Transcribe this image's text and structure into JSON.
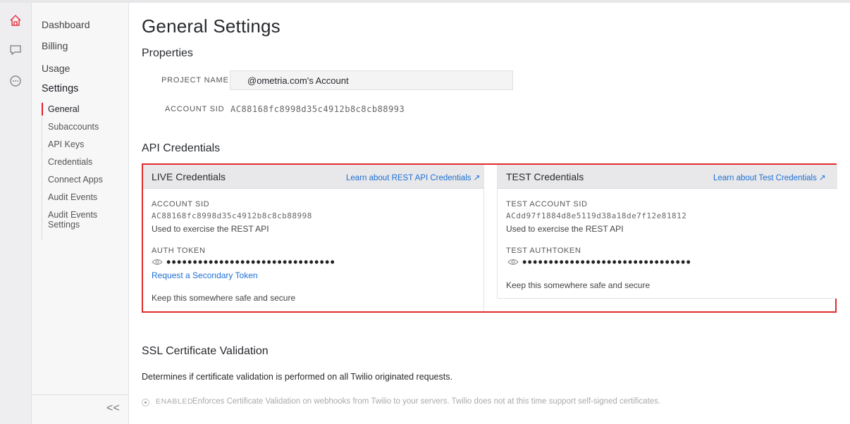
{
  "rail": {
    "icons": [
      "home-icon",
      "chat-icon",
      "more-icon"
    ]
  },
  "nav": {
    "items": [
      "Dashboard",
      "Billing",
      "Usage",
      "Settings"
    ],
    "sub_items": [
      "General",
      "Subaccounts",
      "API Keys",
      "Credentials",
      "Connect Apps",
      "Audit Events",
      "Audit Events Settings"
    ],
    "collapse_label": "<<"
  },
  "page": {
    "title": "General Settings",
    "properties_title": "Properties",
    "project_name_label": "PROJECT NAME",
    "project_name_value": "@ometria.com's Account",
    "account_sid_label": "ACCOUNT SID",
    "account_sid_value": "AC88168fc8998d35c4912b8c8cb88993"
  },
  "credentials": {
    "title": "API Credentials",
    "live": {
      "title": "LIVE Credentials",
      "link": "Learn about REST API Credentials ↗",
      "sid_label": "ACCOUNT SID",
      "sid_value": "AC88168fc8998d35c4912b8c8cb88998",
      "sid_help": "Used to exercise the REST API",
      "token_label": "AUTH TOKEN",
      "token_dots": "••••••••••••••••••••••••••••••••",
      "secondary_link": "Request a Secondary Token",
      "safe_note": "Keep this somewhere safe and secure"
    },
    "test": {
      "title": "TEST Credentials",
      "link": "Learn about Test Credentials ↗",
      "sid_label": "TEST ACCOUNT SID",
      "sid_value": "ACdd97f1884d8e5119d38a18de7f12e81812",
      "sid_help": "Used to exercise the REST API",
      "token_label": "TEST AUTHTOKEN",
      "token_dots": "••••••••••••••••••••••••••••••••",
      "safe_note": "Keep this somewhere safe and secure"
    }
  },
  "ssl": {
    "title": "SSL Certificate Validation",
    "description": "Determines if certificate validation is performed on all Twilio originated requests.",
    "radio_label": "ENABLED",
    "radio_text": "Enforces Certificate Validation on webhooks from Twilio to your servers. Twilio does not at this time support self-signed certificates."
  },
  "colors": {
    "accent": "#e31e2d",
    "link": "#1e6fd3",
    "highlight_border": "#e02b2b"
  }
}
